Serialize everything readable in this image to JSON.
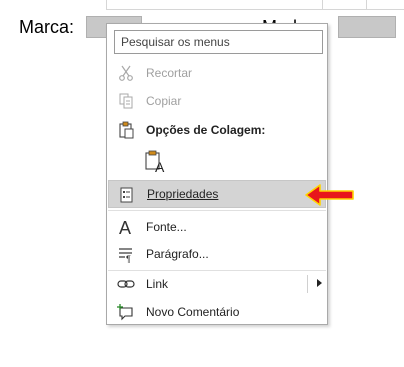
{
  "document": {
    "field_label_1": "Marca:",
    "field_label_2_partial": "Mod"
  },
  "menu": {
    "search_placeholder": "Pesquisar os menus",
    "items": {
      "recortar": "Recortar",
      "copiar": "Copiar",
      "opcoes_colagem": "Opções de Colagem:",
      "propriedades": "Propriedades",
      "fonte": "Fonte...",
      "paragrafo": "Parágrafo...",
      "link": "Link",
      "novo_comentario": "Novo Comentário"
    },
    "icons": [
      "scissors-icon",
      "copy-icon",
      "paste-options-icon",
      "paste-keep-text-icon",
      "properties-icon",
      "font-icon",
      "paragraph-icon",
      "link-icon",
      "new-comment-icon",
      "submenu-arrow-icon"
    ]
  },
  "annotation": {
    "arrow_color": "#e8161b",
    "arrow_outline": "#ffd400"
  },
  "colors": {
    "highlight": "#d4d4d4",
    "field_fill": "#c8c8c8"
  }
}
